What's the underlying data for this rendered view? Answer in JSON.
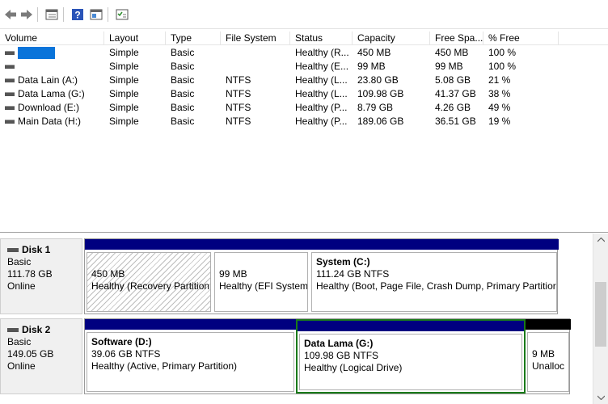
{
  "toolbar": {
    "buttons": [
      {
        "name": "back-icon"
      },
      {
        "name": "forward-icon"
      },
      {
        "name": "disk-list-icon"
      },
      {
        "name": "help-icon"
      },
      {
        "name": "properties-icon"
      },
      {
        "name": "settings-icon"
      }
    ]
  },
  "volume_list": {
    "headers": [
      "Volume",
      "Layout",
      "Type",
      "File System",
      "Status",
      "Capacity",
      "Free Spa...",
      "% Free"
    ],
    "rows": [
      {
        "volume": "",
        "selected": true,
        "layout": "Simple",
        "type": "Basic",
        "fs": "",
        "status": "Healthy (R...",
        "capacity": "450 MB",
        "free": "450 MB",
        "pct": "100 %"
      },
      {
        "volume": "",
        "selected": false,
        "layout": "Simple",
        "type": "Basic",
        "fs": "",
        "status": "Healthy (E...",
        "capacity": "99 MB",
        "free": "99 MB",
        "pct": "100 %"
      },
      {
        "volume": "Data Lain (A:)",
        "selected": false,
        "layout": "Simple",
        "type": "Basic",
        "fs": "NTFS",
        "status": "Healthy (L...",
        "capacity": "23.80 GB",
        "free": "5.08 GB",
        "pct": "21 %"
      },
      {
        "volume": "Data Lama (G:)",
        "selected": false,
        "layout": "Simple",
        "type": "Basic",
        "fs": "NTFS",
        "status": "Healthy (L...",
        "capacity": "109.98 GB",
        "free": "41.37 GB",
        "pct": "38 %"
      },
      {
        "volume": "Download (E:)",
        "selected": false,
        "layout": "Simple",
        "type": "Basic",
        "fs": "NTFS",
        "status": "Healthy (P...",
        "capacity": "8.79 GB",
        "free": "4.26 GB",
        "pct": "49 %"
      },
      {
        "volume": "Main Data (H:)",
        "selected": false,
        "layout": "Simple",
        "type": "Basic",
        "fs": "NTFS",
        "status": "Healthy (P...",
        "capacity": "189.06 GB",
        "free": "36.51 GB",
        "pct": "19 %"
      }
    ]
  },
  "disks": [
    {
      "name": "Disk 1",
      "kind": "Basic",
      "size": "111.78 GB",
      "state": "Online",
      "partitions": [
        {
          "label": "",
          "size": "450 MB",
          "status": "Healthy (Recovery Partition",
          "hatched": true
        },
        {
          "label": "",
          "size": "99 MB",
          "status": "Healthy (EFI System",
          "hatched": false
        },
        {
          "label": "System  (C:)",
          "size": "111.24 GB NTFS",
          "status": "Healthy (Boot, Page File, Crash Dump, Primary Partitior",
          "hatched": false
        }
      ]
    },
    {
      "name": "Disk 2",
      "kind": "Basic",
      "size": "149.05 GB",
      "state": "Online",
      "partitions": [
        {
          "label": "Software  (D:)",
          "size": "39.06 GB NTFS",
          "status": "Healthy (Active, Primary Partition)",
          "hatched": false
        },
        {
          "label": "Data Lama  (G:)",
          "size": "109.98 GB NTFS",
          "status": "Healthy (Logical Drive)",
          "hatched": false,
          "selected": true
        },
        {
          "label": "",
          "size": "9 MB",
          "status": "Unalloc",
          "hatched": false,
          "unallocated": true
        }
      ]
    }
  ],
  "colors": {
    "primary_bar": "#000080",
    "unallocated_bar": "#000000",
    "selection": "#0a74da",
    "selected_border": "#1a7a1a"
  }
}
